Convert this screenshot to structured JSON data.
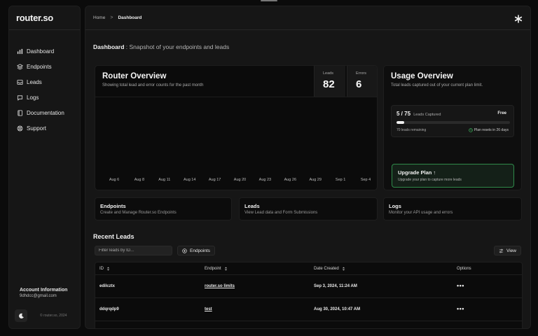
{
  "app": {
    "logo": "router.so"
  },
  "sidebar": {
    "items": [
      {
        "label": "Dashboard",
        "icon": "bar-chart-icon"
      },
      {
        "label": "Endpoints",
        "icon": "layers-icon"
      },
      {
        "label": "Leads",
        "icon": "inbox-icon"
      },
      {
        "label": "Logs",
        "icon": "chat-icon"
      },
      {
        "label": "Documentation",
        "icon": "book-icon"
      },
      {
        "label": "Support",
        "icon": "lifebuoy-icon"
      }
    ],
    "account": {
      "title": "Account Information",
      "email": "9dhdcc@gmail.com"
    },
    "copyright": "© router.so, 2024"
  },
  "header": {
    "breadcrumb_home": "Home",
    "breadcrumb_sep": ">",
    "breadcrumb_current": "Dashboard"
  },
  "page": {
    "title": "Dashboard",
    "subtitle": ": Snapshot of your endpoints and leads"
  },
  "router_overview": {
    "title": "Router Overview",
    "subtitle": "Showing total lead and error counts for the past month",
    "leads_label": "Leads",
    "leads_value": "82",
    "errors_label": "Errors",
    "errors_value": "6",
    "x_ticks": [
      "Aug 6",
      "Aug 8",
      "Aug 11",
      "Aug 14",
      "Aug 17",
      "Aug 20",
      "Aug 23",
      "Aug 26",
      "Aug 29",
      "Sep 1",
      "Sep 4"
    ]
  },
  "usage_overview": {
    "title": "Usage Overview",
    "subtitle": "Total leads captured out of your current plan limit.",
    "count": "5 / 75",
    "count_label": "Leads Captured",
    "plan": "Free",
    "used_fraction": 0.0667,
    "remaining": "70 leads remaining",
    "reset": "Plan resets in 26 days",
    "upgrade_title": "Upgrade Plan ↑",
    "upgrade_sub": "Upgrade your plan to capture more leads"
  },
  "cards": [
    {
      "title": "Endpoints",
      "sub": "Create and Manage Router.so Endpoints"
    },
    {
      "title": "Leads",
      "sub": "View Lead data and Form Submissions"
    },
    {
      "title": "Logs",
      "sub": "Monitor your API usage and errors"
    }
  ],
  "recent_leads": {
    "title": "Recent Leads",
    "filter_placeholder": "Filter leads by ID...",
    "endpoints_button": "Endpoints",
    "view_button": "View",
    "columns": {
      "id": "ID",
      "endpoint": "Endpoint",
      "date": "Date Created",
      "options": "Options"
    },
    "rows": [
      {
        "id": "edilcztx",
        "endpoint": "router.so limits",
        "date": "Sep 3, 2024, 11:24 AM",
        "options": "•••"
      },
      {
        "id": "ddqrqdp9",
        "endpoint": "test",
        "date": "Aug 30, 2024, 10:47 AM",
        "options": "•••"
      }
    ]
  }
}
